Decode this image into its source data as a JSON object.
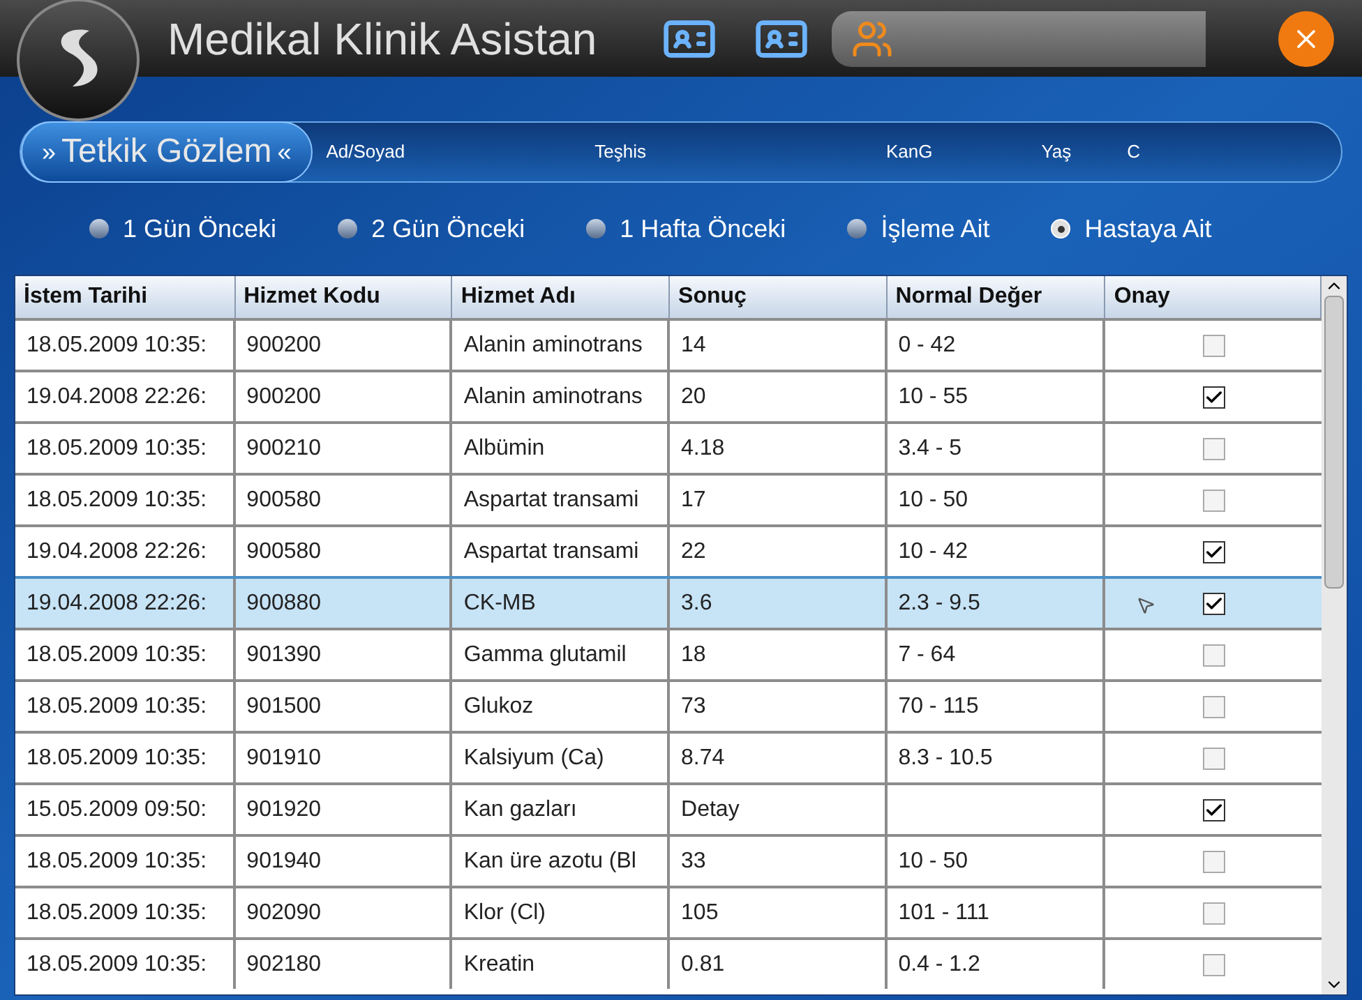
{
  "app": {
    "title": "Medikal Klinik Asistan"
  },
  "panel": {
    "title": "Tetkik Gözlem",
    "left_mark": "»",
    "right_mark": "«",
    "fields": [
      "Ad/Soyad",
      "Teşhis",
      "KanG",
      "Yaş",
      "C"
    ]
  },
  "filters": [
    {
      "label": "1 Gün Önceki",
      "selected": false
    },
    {
      "label": "2 Gün Önceki",
      "selected": false
    },
    {
      "label": "1 Hafta Önceki",
      "selected": false
    },
    {
      "label": "İşleme Ait",
      "selected": false
    },
    {
      "label": "Hastaya Ait",
      "selected": true
    }
  ],
  "table": {
    "columns": [
      "İstem Tarihi",
      "Hizmet Kodu",
      "Hizmet Adı",
      "Sonuç",
      "Normal Değer",
      "Onay"
    ],
    "rows": [
      {
        "cells": [
          "18.05.2009 10:35:",
          "900200",
          "Alanin aminotrans",
          "14",
          "0 - 42"
        ],
        "checked": false,
        "selected": false
      },
      {
        "cells": [
          "19.04.2008 22:26:",
          "900200",
          "Alanin aminotrans",
          "20",
          "10 - 55"
        ],
        "checked": true,
        "selected": false
      },
      {
        "cells": [
          "18.05.2009 10:35:",
          "900210",
          "Albümin",
          "4.18",
          "3.4 - 5"
        ],
        "checked": false,
        "selected": false
      },
      {
        "cells": [
          "18.05.2009 10:35:",
          "900580",
          "Aspartat transami",
          "17",
          "10 - 50"
        ],
        "checked": false,
        "selected": false
      },
      {
        "cells": [
          "19.04.2008 22:26:",
          "900580",
          "Aspartat transami",
          "22",
          "10 - 42"
        ],
        "checked": true,
        "selected": false
      },
      {
        "cells": [
          "19.04.2008 22:26:",
          "900880",
          "CK-MB",
          "3.6",
          "2.3 - 9.5"
        ],
        "checked": true,
        "selected": true
      },
      {
        "cells": [
          "18.05.2009 10:35:",
          "901390",
          "Gamma glutamil",
          "18",
          "7 - 64"
        ],
        "checked": false,
        "selected": false
      },
      {
        "cells": [
          "18.05.2009 10:35:",
          "901500",
          "Glukoz",
          "73",
          "70 - 115"
        ],
        "checked": false,
        "selected": false
      },
      {
        "cells": [
          "18.05.2009 10:35:",
          "901910",
          "Kalsiyum (Ca)",
          "8.74",
          "8.3 - 10.5"
        ],
        "checked": false,
        "selected": false
      },
      {
        "cells": [
          "15.05.2009 09:50:",
          "901920",
          "Kan gazları",
          "Detay",
          ""
        ],
        "checked": true,
        "selected": false
      },
      {
        "cells": [
          "18.05.2009 10:35:",
          "901940",
          "Kan üre azotu (Bl",
          "33",
          "10 - 50"
        ],
        "checked": false,
        "selected": false
      },
      {
        "cells": [
          "18.05.2009 10:35:",
          "902090",
          "Klor (Cl)",
          "105",
          "101 - 111"
        ],
        "checked": false,
        "selected": false
      },
      {
        "cells": [
          "18.05.2009 10:35:",
          "902180",
          "Kreatin",
          "0.81",
          "0.4 - 1.2"
        ],
        "checked": false,
        "selected": false
      }
    ]
  }
}
